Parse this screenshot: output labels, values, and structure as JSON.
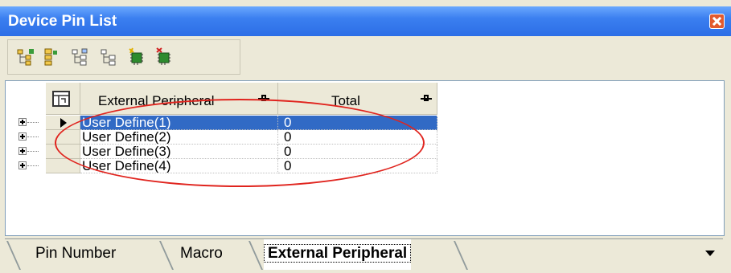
{
  "window": {
    "title": "Device Pin List"
  },
  "toolbar": {
    "icons": [
      "expand-tree-icon",
      "collapse-tree-icon",
      "tree-view-icon",
      "tree-list-icon",
      "chip-add-icon",
      "chip-remove-icon"
    ]
  },
  "grid": {
    "columns": [
      {
        "label": "External Peripheral"
      },
      {
        "label": "Total"
      }
    ],
    "rows": [
      {
        "name": "User Define(1)",
        "total": "0",
        "selected": true
      },
      {
        "name": "User Define(2)",
        "total": "0",
        "selected": false
      },
      {
        "name": "User Define(3)",
        "total": "0",
        "selected": false
      },
      {
        "name": "User Define(4)",
        "total": "0",
        "selected": false
      }
    ]
  },
  "tabs": [
    {
      "label": "Pin Number",
      "active": false
    },
    {
      "label": "Macro",
      "active": false
    },
    {
      "label": "External Peripheral",
      "active": true
    }
  ],
  "colors": {
    "title_bar": "#2c6ee6",
    "selection": "#316ac5",
    "annotation": "#e0241e"
  }
}
